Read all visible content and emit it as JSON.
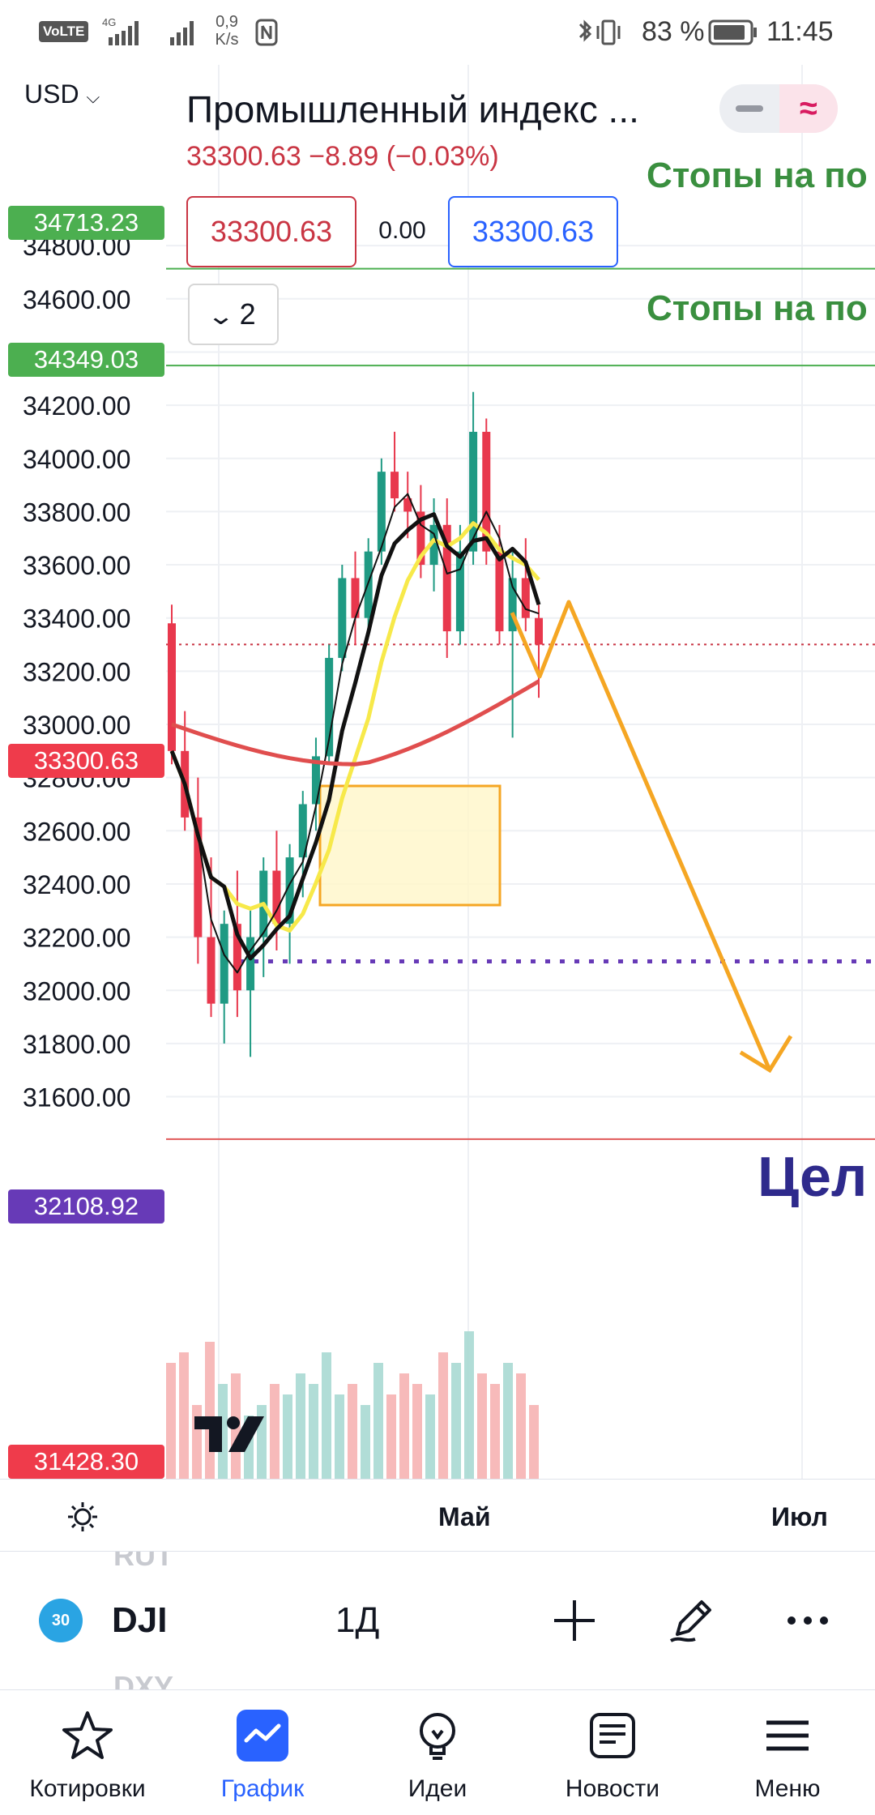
{
  "status_bar": {
    "volte": "VoLTE",
    "network": "4G",
    "speed_value": "0,9",
    "speed_unit": "K/s",
    "battery": "83 %",
    "time": "11:45"
  },
  "header": {
    "currency": "USD",
    "title": "Промышленный индекс ...",
    "price_change": "33300.63  −8.89 (−0.03%)",
    "sell_price": "33300.63",
    "spread": "0.00",
    "buy_price": "33300.63",
    "indicators_count": "2"
  },
  "annotations": {
    "stop_label_1": "Стопы на по",
    "stop_label_2": "Стопы на по",
    "target_label": "Цел"
  },
  "price_axis": {
    "ticks": [
      "34800.00",
      "34600.00",
      "34400.00",
      "34200.00",
      "34000.00",
      "33800.00",
      "33600.00",
      "33400.00",
      "33200.00",
      "33000.00",
      "32800.00",
      "32600.00",
      "32400.00",
      "32200.00",
      "32000.00",
      "31800.00",
      "31600.00"
    ],
    "levels": {
      "stop_1": "34713.23",
      "stop_2": "34349.03",
      "last_price": "33300.63",
      "target_dotted": "32108.92",
      "bottom_level": "31428.30"
    }
  },
  "time_axis": {
    "labels": [
      "Май",
      "Июл"
    ]
  },
  "colors": {
    "up": "#26a69a",
    "down": "#ef5350",
    "stop_line": "#4caf50",
    "target_line": "#673ab7",
    "arrow": "#f5a623",
    "accent": "#2962ff"
  },
  "toolbar": {
    "badge": "30",
    "ticker": "DJI",
    "interval": "1Д",
    "ghost_above": "RUT",
    "ghost_below": "DXY"
  },
  "nav": {
    "items": [
      {
        "label": "Котировки",
        "icon": "star-icon"
      },
      {
        "label": "График",
        "icon": "chart-icon"
      },
      {
        "label": "Идеи",
        "icon": "lightbulb-icon"
      },
      {
        "label": "Новости",
        "icon": "news-icon"
      },
      {
        "label": "Меню",
        "icon": "menu-icon"
      }
    ],
    "active": "График"
  },
  "chart_data": {
    "type": "candlestick",
    "symbol": "DJI",
    "interval": "1D",
    "ylim": [
      31428.3,
      34900
    ],
    "ticks": [
      34800,
      34600,
      34400,
      34200,
      34000,
      33800,
      33600,
      33400,
      33200,
      33000,
      32800,
      32600,
      32400,
      32200,
      32000,
      31800,
      31600
    ],
    "x_labels": [
      "Май",
      "Июл"
    ],
    "last_price": 33300.63,
    "horizontal_levels": [
      34713.23,
      34349.03,
      32108.92,
      31428.3
    ],
    "candles_ohlc": [
      [
        33380,
        33450,
        32850,
        32900
      ],
      [
        32900,
        33050,
        32600,
        32650
      ],
      [
        32650,
        32800,
        32100,
        32200
      ],
      [
        32200,
        32500,
        31900,
        31950
      ],
      [
        31950,
        32300,
        31800,
        32250
      ],
      [
        32250,
        32450,
        31900,
        32000
      ],
      [
        32000,
        32300,
        31750,
        32200
      ],
      [
        32200,
        32500,
        32050,
        32450
      ],
      [
        32450,
        32600,
        32150,
        32250
      ],
      [
        32250,
        32550,
        32100,
        32500
      ],
      [
        32500,
        32750,
        32350,
        32700
      ],
      [
        32700,
        32950,
        32600,
        32880
      ],
      [
        32880,
        33300,
        32850,
        33250
      ],
      [
        33250,
        33600,
        33200,
        33550
      ],
      [
        33550,
        33650,
        33300,
        33400
      ],
      [
        33400,
        33700,
        33350,
        33650
      ],
      [
        33650,
        34000,
        33600,
        33950
      ],
      [
        33950,
        34100,
        33800,
        33850
      ],
      [
        33850,
        33950,
        33700,
        33800
      ],
      [
        33800,
        33900,
        33550,
        33600
      ],
      [
        33600,
        33850,
        33500,
        33750
      ],
      [
        33750,
        33850,
        33250,
        33350
      ],
      [
        33350,
        33750,
        33300,
        33650
      ],
      [
        33650,
        34250,
        33600,
        34100
      ],
      [
        34100,
        34150,
        33600,
        33650
      ],
      [
        33650,
        33750,
        33300,
        33350
      ],
      [
        33350,
        33650,
        32950,
        33550
      ],
      [
        33550,
        33700,
        33350,
        33400
      ],
      [
        33400,
        33450,
        33100,
        33300
      ]
    ],
    "volume_relative": [
      0.55,
      0.6,
      0.35,
      0.65,
      0.45,
      0.5,
      0.3,
      0.35,
      0.45,
      0.4,
      0.5,
      0.45,
      0.6,
      0.4,
      0.45,
      0.35,
      0.55,
      0.4,
      0.5,
      0.45,
      0.4,
      0.6,
      0.55,
      0.7,
      0.5,
      0.45,
      0.55,
      0.5,
      0.35
    ],
    "projection": [
      33340,
      33190,
      33460,
      31700
    ]
  }
}
